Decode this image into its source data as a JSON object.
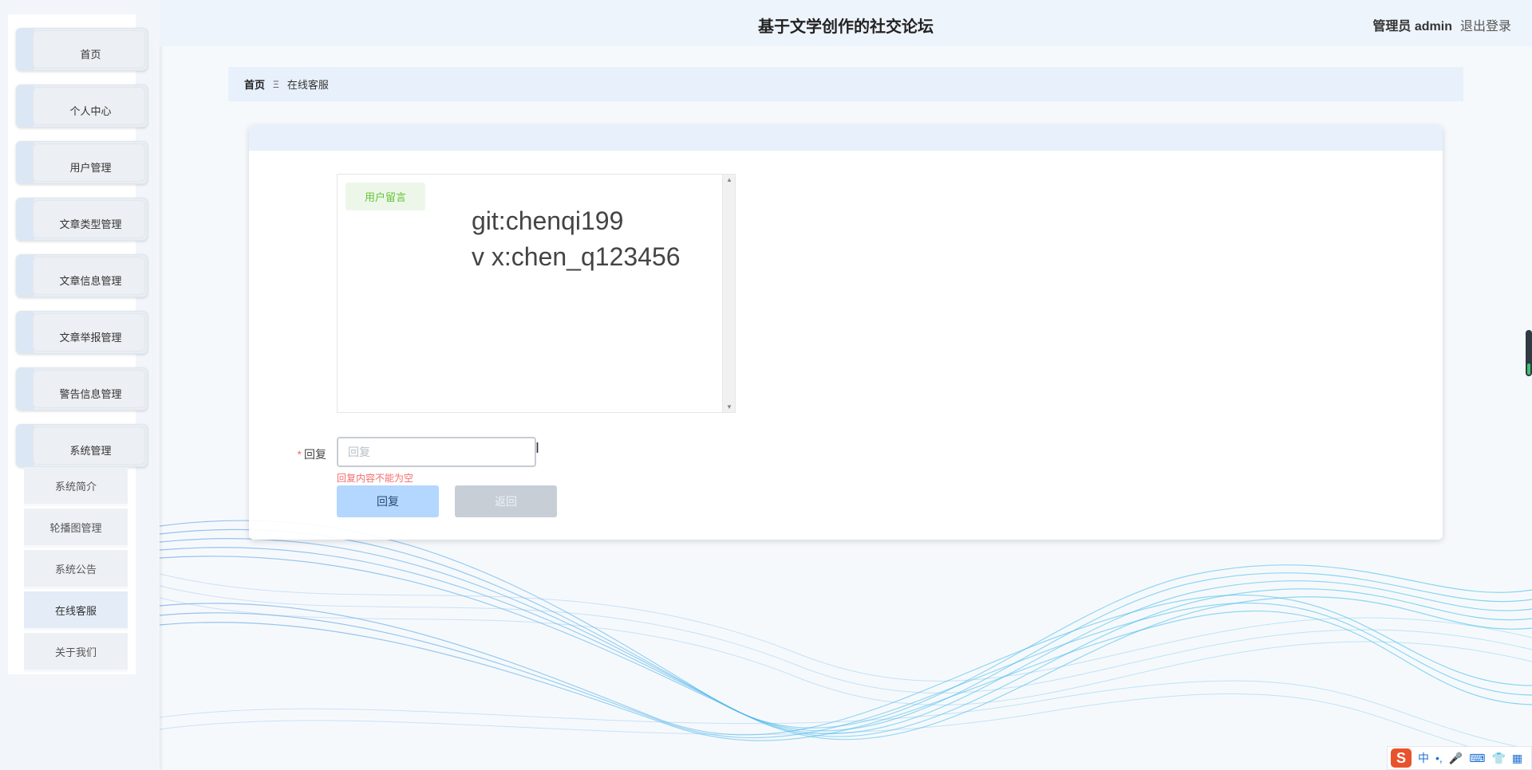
{
  "header": {
    "title": "基于文学创作的社交论坛",
    "user": "管理员 admin",
    "logout": "退出登录"
  },
  "sidebar": {
    "items": [
      {
        "label": "首页"
      },
      {
        "label": "个人中心"
      },
      {
        "label": "用户管理"
      },
      {
        "label": "文章类型管理"
      },
      {
        "label": "文章信息管理"
      },
      {
        "label": "文章举报管理"
      },
      {
        "label": "警告信息管理"
      },
      {
        "label": "系统管理"
      }
    ],
    "submenu": [
      {
        "label": "系统简介"
      },
      {
        "label": "轮播图管理"
      },
      {
        "label": "系统公告"
      },
      {
        "label": "在线客服"
      },
      {
        "label": "关于我们"
      }
    ]
  },
  "breadcrumb": {
    "home": "首页",
    "separator": "Ξ",
    "current": "在线客服"
  },
  "chat": {
    "tag": "用户留言",
    "lines": [
      "git:chenqi199",
      "v x:chen_q123456"
    ]
  },
  "form": {
    "label": "回复",
    "required_mark": "*",
    "placeholder": "回复",
    "value": "",
    "error": "回复内容不能为空",
    "reply_button": "回复",
    "back_button": "返回"
  },
  "ime": {
    "logo": "S",
    "mode": "中",
    "punct": "•,",
    "icons": [
      "microphone-icon",
      "keyboard-icon",
      "skin-icon",
      "grid-icon"
    ]
  },
  "colors": {
    "accent": "#b3d7ff",
    "error": "#f56c6c",
    "tag_green": "#67c23a",
    "header_bg": "#eef4fb"
  }
}
